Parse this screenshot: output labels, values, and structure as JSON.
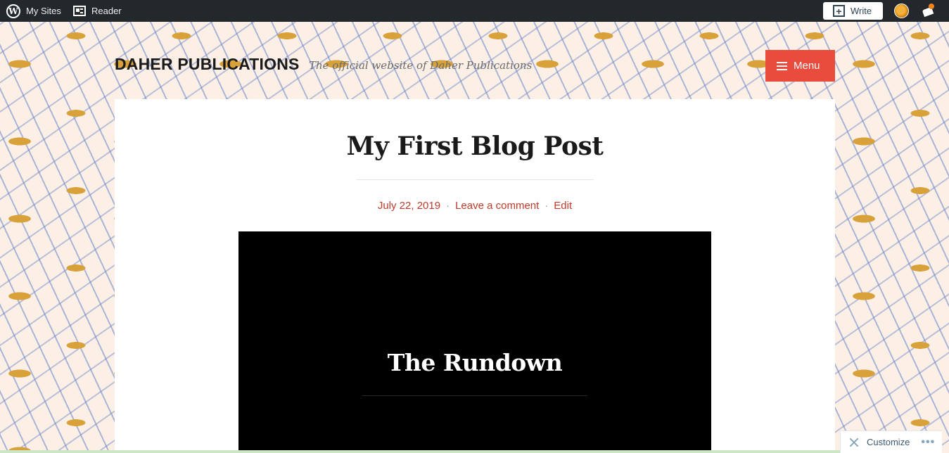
{
  "adminbar": {
    "my_sites_label": "My Sites",
    "my_sites_icon": "wordpress-logo-icon",
    "reader_label": "Reader",
    "reader_icon": "reader-icon",
    "write_label": "Write",
    "write_icon": "write-plus-icon",
    "avatar_icon": "user-avatar",
    "notifications_icon": "notifications-icon",
    "notification_dot_color": "#f0821e"
  },
  "site": {
    "title": "DAHER PUBLICATIONS",
    "description": "The official website of Daher Publications",
    "menu_label": "Menu",
    "menu_icon": "hamburger-icon",
    "menu_color": "#e94b3c"
  },
  "post": {
    "title": "My First Blog Post",
    "date": "July 22, 2019",
    "separator": "·",
    "comment_link": "Leave a comment",
    "edit_link": "Edit",
    "link_color": "#c0392b"
  },
  "featured_image": {
    "title": "The Rundown",
    "background": "#000000"
  },
  "customize": {
    "label": "Customize",
    "icon": "tools-icon",
    "more_icon": "ellipsis-icon",
    "more_glyph": "•••"
  }
}
